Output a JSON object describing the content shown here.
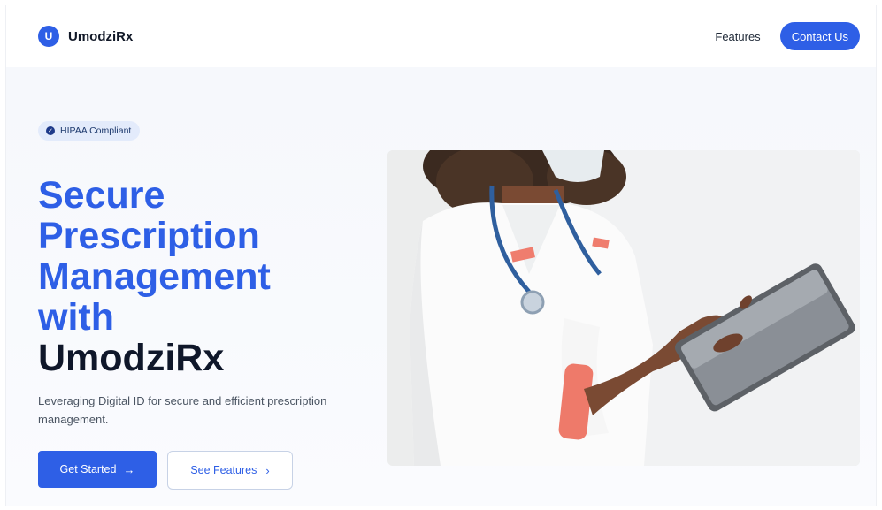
{
  "brand": {
    "logo_letter": "U",
    "name": "UmodziRx"
  },
  "nav": {
    "features_label": "Features",
    "contact_label": "Contact Us"
  },
  "hero": {
    "badge": "HIPAA Compliant",
    "headline_line1": "Secure",
    "headline_line2": "Prescription",
    "headline_line3": "Management",
    "headline_line4": "with",
    "headline_line5": "UmodziRx",
    "subtext": "Leveraging Digital ID for secure and efficient prescription management.",
    "primary_cta": "Get Started",
    "secondary_cta": "See Features",
    "arrow_right": "→",
    "chevron_right": "›"
  },
  "colors": {
    "brand": "#2e5fe6",
    "dark_text": "#0f172a",
    "hero_bg": "#f6f8fc"
  }
}
